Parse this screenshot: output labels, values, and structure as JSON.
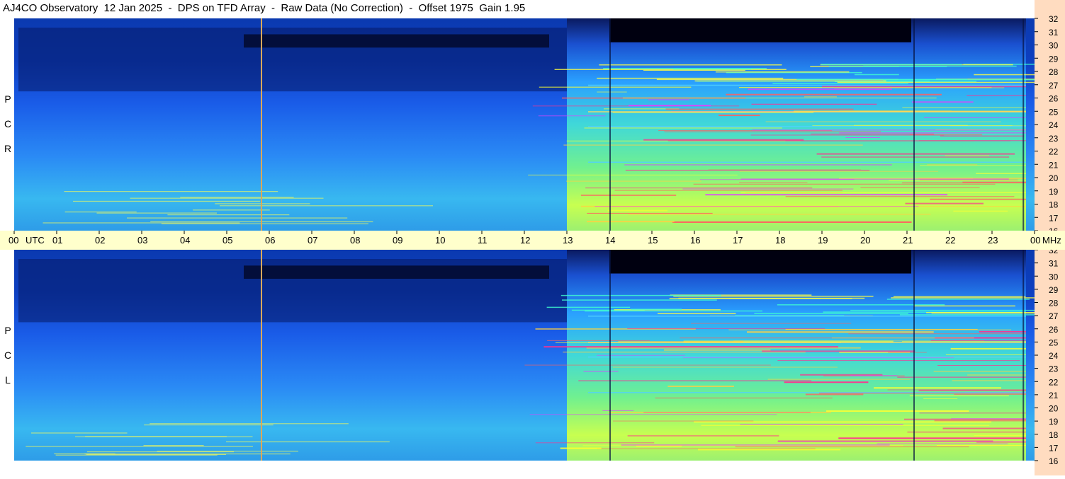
{
  "title": "AJ4CO Observatory  12 Jan 2025  -  DPS on TFD Array  -  Raw Data (No Correction)  -  Offset 1975  Gain 1.95",
  "panels": [
    {
      "label_letters": [
        "P",
        "C",
        "R"
      ],
      "polarization": "RCP"
    },
    {
      "label_letters": [
        "P",
        "C",
        "L"
      ],
      "polarization": "LCP"
    }
  ],
  "chart_data": {
    "type": "heatmap",
    "title": "AJ4CO Observatory  12 Jan 2025  -  DPS on TFD Array  -  Raw Data (No Correction)  -  Offset 1975  Gain 1.95",
    "x_axis": {
      "label": "UTC",
      "ticks": [
        "00",
        "01",
        "02",
        "03",
        "04",
        "05",
        "06",
        "07",
        "08",
        "09",
        "10",
        "11",
        "12",
        "13",
        "14",
        "15",
        "16",
        "17",
        "18",
        "19",
        "20",
        "21",
        "22",
        "23",
        "00"
      ],
      "range_hours": [
        0,
        24
      ]
    },
    "y_axis": {
      "label": "MHz",
      "ticks": [
        32,
        31,
        30,
        29,
        28,
        27,
        26,
        25,
        24,
        23,
        22,
        21,
        20,
        19,
        18,
        17,
        16
      ],
      "range_mhz": [
        16,
        32
      ]
    },
    "panels": [
      "RCP",
      "LCP"
    ],
    "colormap": [
      "#000010",
      "#0a2a9a",
      "#1f5cf0",
      "#2fa0ff",
      "#45e0d0",
      "#9cff50",
      "#ffff30",
      "#ff3090"
    ],
    "features": {
      "vertical_marker_utc": 5.8,
      "marker_color": "#d9a85a",
      "quiet_night_band_utc": [
        5.4,
        13.0
      ],
      "daytime_activity_utc": [
        13.0,
        23.8
      ]
    }
  },
  "colors": {
    "time_bar": "#ffffcc",
    "freq_bar": "#ffdcc0",
    "background": "#ffffff"
  }
}
